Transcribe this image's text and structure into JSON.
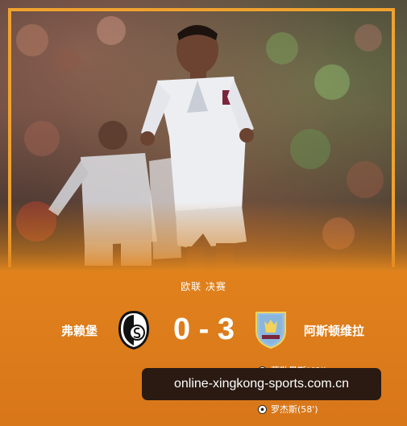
{
  "competition": "欧联 决赛",
  "home_team": {
    "name": "弗赖堡",
    "score": "0"
  },
  "away_team": {
    "name": "阿斯顿维拉",
    "score": "3"
  },
  "score_text": "0 - 3",
  "scorers": [
    {
      "name": "蒂勒曼斯(41')"
    },
    {
      "name": "罗杰斯(58')"
    }
  ],
  "watermark": "online-xingkong-sports.com.cn",
  "colors": {
    "background": "#e4871d",
    "frame": "#f0a22e",
    "watermark_bg": "#2a1a12",
    "villa_claret": "#7a263a",
    "villa_blue": "#95bfe5"
  }
}
